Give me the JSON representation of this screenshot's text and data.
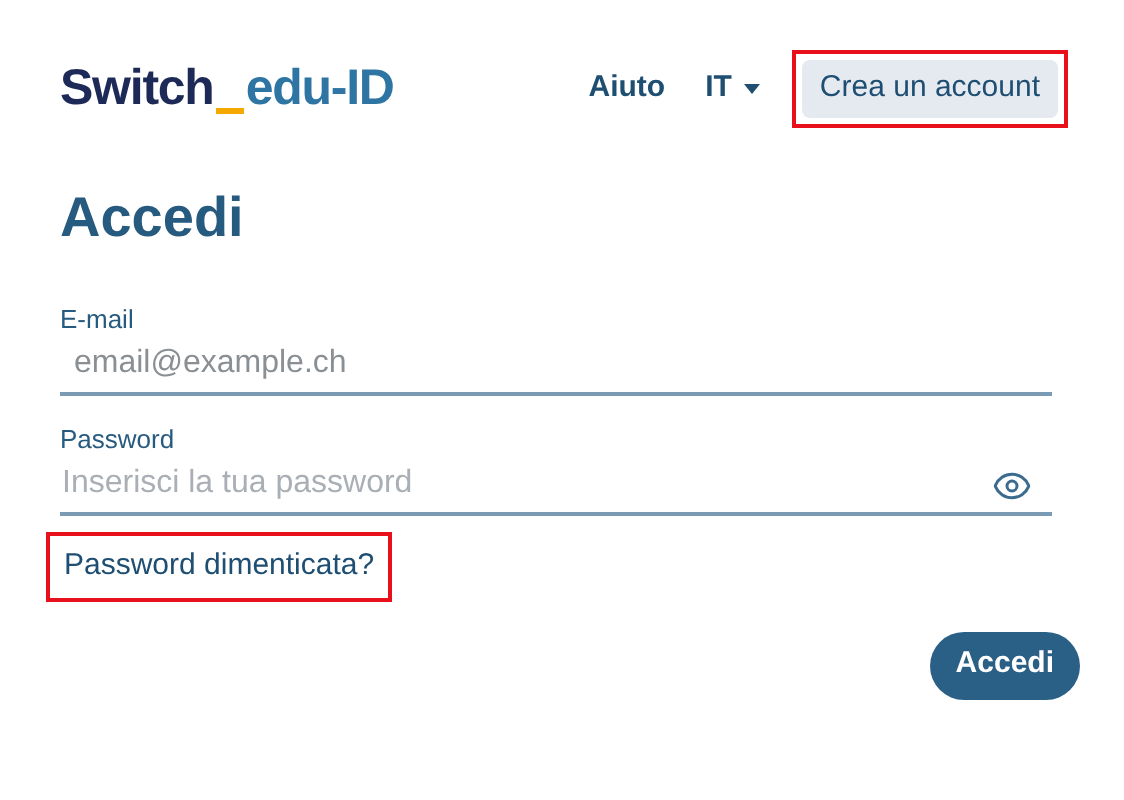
{
  "logo": {
    "primary": "Switch",
    "secondary": "edu-ID"
  },
  "nav": {
    "help": "Aiuto",
    "language": "IT",
    "create_account": {
      "label": "Crea un account",
      "highlighted": true
    }
  },
  "heading": "Accedi",
  "fields": [
    {
      "label": "E-mail",
      "placeholder": "email@example.ch",
      "kind": "text"
    },
    {
      "label": "Password",
      "placeholder": "Inserisci la tua password",
      "kind": "password"
    }
  ],
  "forgot_link": {
    "label": "Password dimenticata?",
    "highlighted": true
  },
  "submit": "Accedi"
}
